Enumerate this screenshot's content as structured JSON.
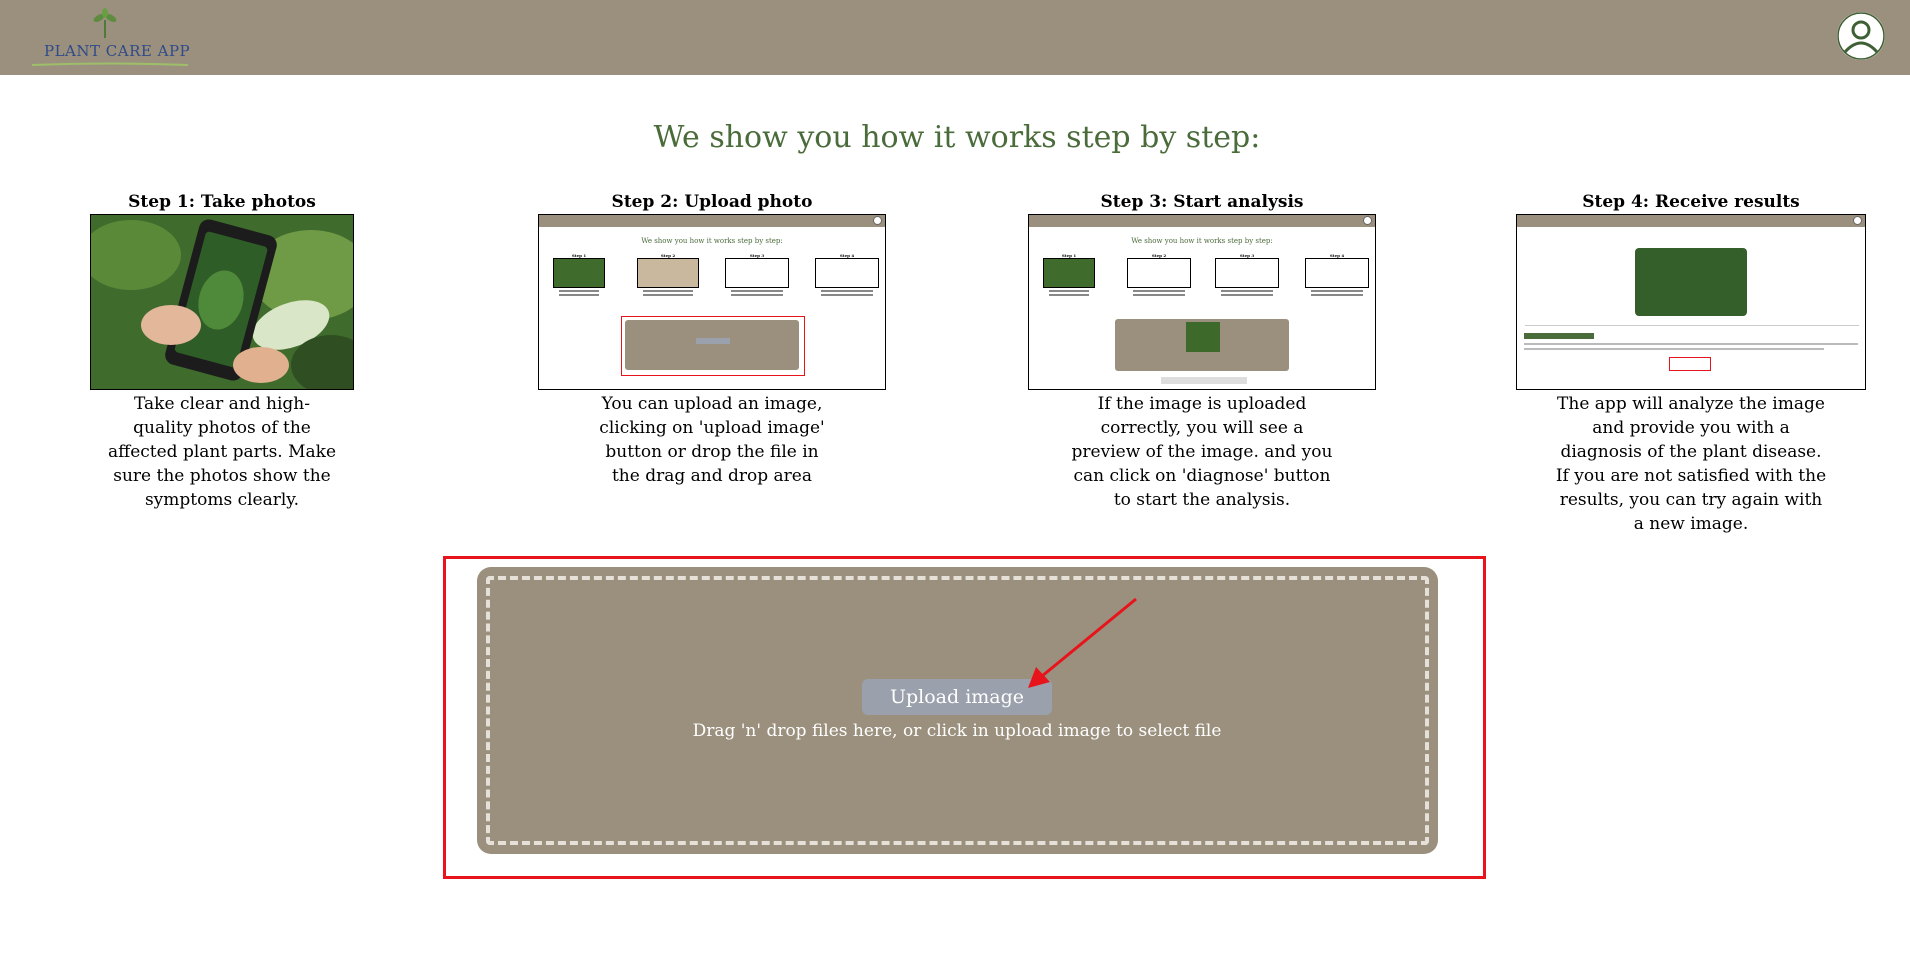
{
  "header": {
    "logo_text": "PLANT CARE APP",
    "background": "#9b907d"
  },
  "main": {
    "heading": "We show you how it works step by step:",
    "heading_color": "#4a6b3a",
    "steps": [
      {
        "title": "Step 1: Take photos",
        "description": "Take clear and high-quality photos of the affected plant parts. Make sure the photos show the symptoms clearly."
      },
      {
        "title": "Step 2: Upload photo",
        "description": "You can upload an image, clicking on 'upload image' button or drop the file in the drag and drop area"
      },
      {
        "title": "Step 3: Start analysis",
        "description": "If the image is uploaded correctly, you will see a preview of the image. and you can click on 'diagnose' button to start the analysis."
      },
      {
        "title": "Step 4: Receive results",
        "description": "The app will analyze the image and provide you with a diagnosis of the plant disease. If you are not satisfied with the results, you can try again with a new image."
      }
    ]
  },
  "dropzone": {
    "upload_button": "Upload image",
    "hint": "Drag 'n' drop files here, or click in upload image to select file",
    "highlight_color": "#e8141c"
  },
  "icons": [
    "plant-logo-icon",
    "user-avatar-icon",
    "arrow-pointer-icon"
  ]
}
